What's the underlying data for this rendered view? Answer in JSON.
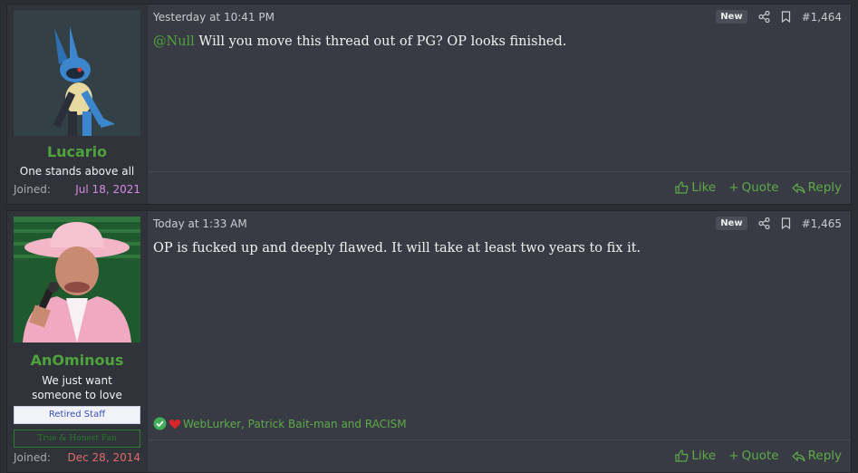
{
  "posts": [
    {
      "author": "Lucario",
      "user_title": "One stands above all",
      "joined_label": "Joined:",
      "joined_date": "Jul 18, 2021",
      "joined_color": "#d58be0",
      "date": "Yesterday at 10:41 PM",
      "badge": "New",
      "post_number": "#1,464",
      "mention": "@Null",
      "body": " Will you move this thread out of PG? OP looks finished.",
      "actions": {
        "like": "Like",
        "quote": "Quote",
        "reply": "Reply"
      }
    },
    {
      "author": "AnOminous",
      "user_title": "We just want someone to love",
      "banner_staff": "Retired Staff",
      "banner_green": "True & Honest Fan",
      "joined_label": "Joined:",
      "joined_date": "Dec 28, 2014",
      "joined_color": "#e06a6a",
      "date": "Today at 1:33 AM",
      "badge": "New",
      "post_number": "#1,465",
      "body": "OP is fucked up and deeply flawed. It will take at least two years to fix it.",
      "reactions_text": "WebLurker, Patrick Bait-man and RACISM",
      "actions": {
        "like": "Like",
        "quote": "Quote",
        "reply": "Reply"
      }
    }
  ],
  "icons": [
    "share-icon",
    "bookmark-icon",
    "like-icon",
    "quote-icon",
    "reply-icon",
    "check-reaction-icon",
    "heart-reaction-icon"
  ]
}
